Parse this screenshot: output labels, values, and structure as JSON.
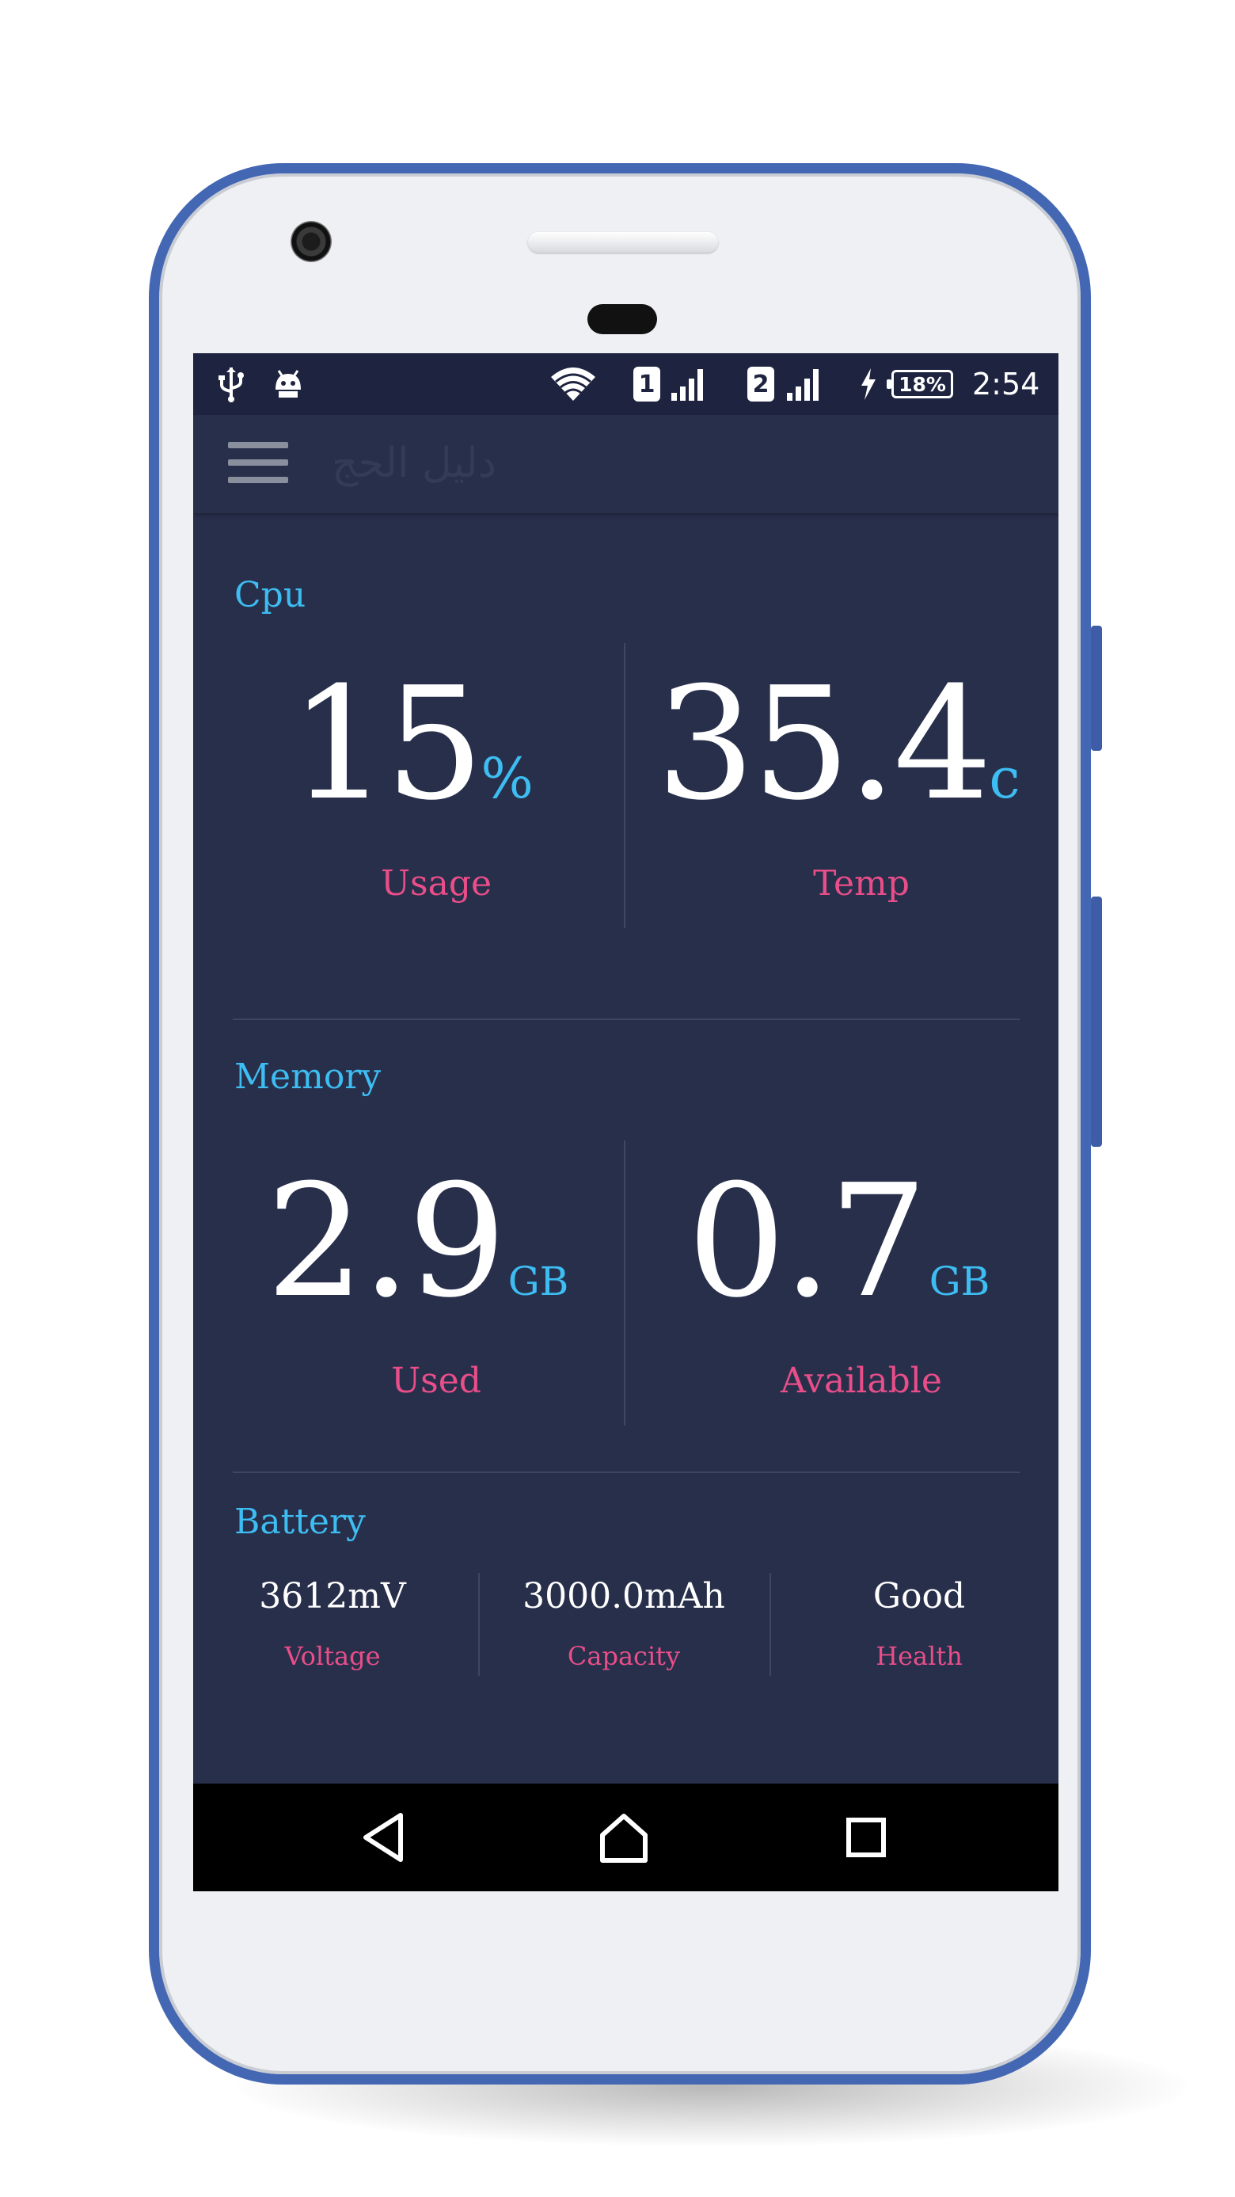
{
  "status_bar": {
    "icons": [
      "usb-icon",
      "android-icon",
      "wifi-icon",
      "sim-1-icon",
      "signal-icon",
      "sim-2-icon",
      "signal-icon",
      "charging-icon",
      "battery-icon"
    ],
    "sim1": "1",
    "sim2": "2",
    "battery_level": "18%",
    "time": "2:54"
  },
  "toolbar": {
    "menu_icon": "hamburger-menu-icon",
    "title": "دليل الحج"
  },
  "cpu": {
    "section_title": "Cpu",
    "usage_value": "15",
    "usage_unit": "%",
    "usage_label": "Usage",
    "temp_value": "35.4",
    "temp_unit": "c",
    "temp_label": "Temp"
  },
  "memory": {
    "section_title": "Memory",
    "used_value": "2.9",
    "used_unit": "GB",
    "used_label": "Used",
    "available_value": "0.7",
    "available_unit": "GB",
    "available_label": "Available"
  },
  "battery": {
    "section_title": "Battery",
    "voltage_value": "3612mV",
    "voltage_label": "Voltage",
    "capacity_value": "3000.0mAh",
    "capacity_label": "Capacity",
    "health_value": "Good",
    "health_label": "Health"
  },
  "nav_bar": {
    "icons": [
      "back-icon",
      "home-icon",
      "recents-icon"
    ]
  },
  "colors": {
    "background": "#282f4b",
    "status_bar": "#1e2440",
    "accent_blue": "#3dbdf2",
    "accent_pink": "#e94e89",
    "phone_frame": "#4467b4"
  }
}
